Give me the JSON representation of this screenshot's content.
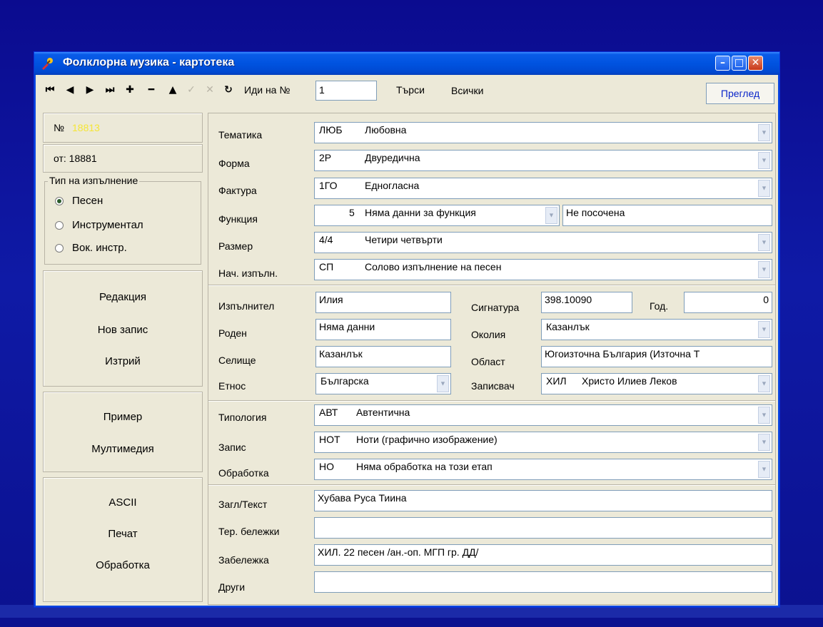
{
  "window": {
    "title": "Фолклорна музика - картотека"
  },
  "toolbar": {
    "goto_label": "Иди на №",
    "goto_value": "1",
    "search_label": "Търси",
    "all_label": "Всички",
    "preview_label": "Преглед"
  },
  "record": {
    "number_label": "№",
    "number_value": "18813",
    "of_label": "от: 18881"
  },
  "performance_type": {
    "title": "Тип на изпълнение",
    "options": [
      "Песен",
      "Инструментал",
      "Вок. инстр."
    ],
    "selected": "Песен"
  },
  "commands": {
    "edit": "Редакция",
    "new_record": "Нов запис",
    "delete": "Изтрий",
    "example": "Пример",
    "multimedia": "Мултимедия",
    "ascii": "ASCII",
    "print": "Печат",
    "processing": "Обработка"
  },
  "fields": {
    "tematika": {
      "label": "Тематика",
      "code": "ЛЮБ",
      "text": "Любовна"
    },
    "forma": {
      "label": "Форма",
      "code": "2Р",
      "text": "Двуредична"
    },
    "faktura": {
      "label": "Фактура",
      "code": "1ГО",
      "text": "Едногласна"
    },
    "funkciya": {
      "label": "Функция",
      "code": "5",
      "text": "Няма данни за функция",
      "extra": "Не посочена"
    },
    "razmer": {
      "label": "Размер",
      "code": "4/4",
      "text": "Четири четвърти"
    },
    "nach_izpalnenie": {
      "label": "Нач. изпълн.",
      "code": "СП",
      "text": "Солово изпълнение на песен"
    },
    "izpalnitel": {
      "label": "Изпълнител",
      "value": "Илия"
    },
    "signatura": {
      "label": "Сигнатура",
      "value": "398.10090"
    },
    "godina": {
      "label": "Год.",
      "value": "0"
    },
    "roden": {
      "label": "Роден",
      "value": "Няма данни"
    },
    "okoliya": {
      "label": "Околия",
      "value": "Казанлък"
    },
    "selishte": {
      "label": "Селище",
      "value": "Казанлък"
    },
    "oblast": {
      "label": "Област",
      "value": "Югоизточна България (Източна Т"
    },
    "etnos": {
      "label": "Етнос",
      "value": "Българска"
    },
    "zapisvach": {
      "label": "Записвач",
      "code": "ХИЛ",
      "text": "Христо Илиев Леков"
    },
    "tipologiya": {
      "label": "Типология",
      "code": "АВТ",
      "text": "Автентична"
    },
    "zapis": {
      "label": "Запис",
      "code": "НОТ",
      "text": "Ноти (графично изображение)"
    },
    "obrabotka": {
      "label": "Обработка",
      "code": "НО",
      "text": "Няма обработка на този етап"
    },
    "zaglavie": {
      "label": "Загл/Текст",
      "value": "Хубава Руса Тиина"
    },
    "ter_belezhki": {
      "label": "Тер. бележки",
      "value": ""
    },
    "belezhka": {
      "label": "Забележка",
      "value": "ХИЛ. 22 песен /ан.-оп. МГП гр. ДД/"
    },
    "drugi": {
      "label": "Други",
      "value": ""
    }
  },
  "colors": {
    "titlebar": "#0053e0",
    "window_bg": "#ece9d8",
    "record_number": "#f5e636",
    "preview_text": "#0a25c9"
  }
}
